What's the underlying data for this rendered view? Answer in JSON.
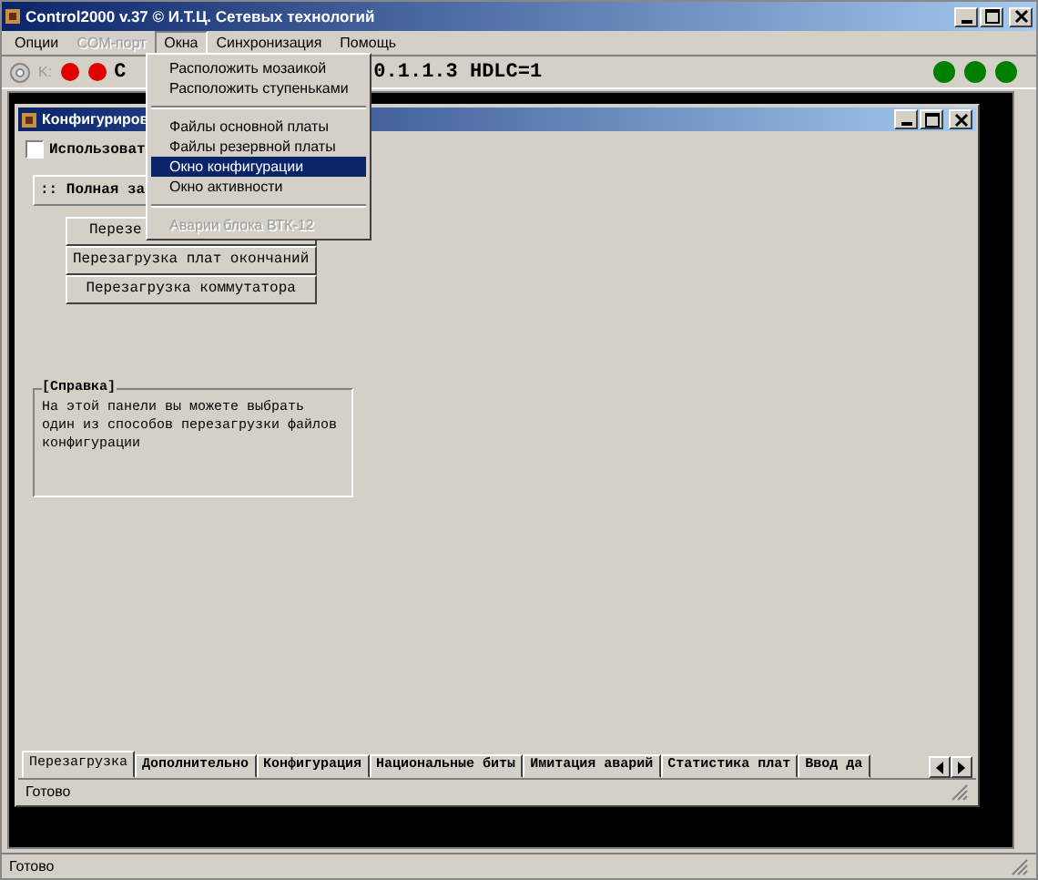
{
  "window": {
    "title": "Control2000 v.37 © И.Т.Ц. Сетевых технологий"
  },
  "menu_bar": [
    {
      "label": "Опции",
      "disabled": false,
      "selected": false
    },
    {
      "label": "COM-порт",
      "disabled": true,
      "selected": false
    },
    {
      "label": "Окна",
      "disabled": false,
      "selected": true
    },
    {
      "label": "Синхронизация",
      "disabled": false,
      "selected": false
    },
    {
      "label": "Помощь",
      "disabled": false,
      "selected": false
    }
  ],
  "toolbar": {
    "port_label": "K:",
    "connection_prefix": "C",
    "connection": "0.1.1.3 HDLC=1"
  },
  "dropdown": [
    {
      "kind": "item",
      "label": "Расположить мозаикой",
      "selected": false,
      "disabled": false
    },
    {
      "kind": "item",
      "label": "Расположить ступеньками",
      "selected": false,
      "disabled": false
    },
    {
      "kind": "separator"
    },
    {
      "kind": "item",
      "label": "Файлы основной платы",
      "selected": false,
      "disabled": false
    },
    {
      "kind": "item",
      "label": "Файлы резервной платы",
      "selected": false,
      "disabled": false
    },
    {
      "kind": "item",
      "label": "Окно конфигурации",
      "selected": true,
      "disabled": false
    },
    {
      "kind": "item",
      "label": "Окно активности",
      "selected": false,
      "disabled": false
    },
    {
      "kind": "separator"
    },
    {
      "kind": "item",
      "label": "Аварии блока ВТК-12",
      "selected": false,
      "disabled": true
    }
  ],
  "child_window": {
    "title": "Конфигуриров",
    "checkbox": {
      "label": "Использоват",
      "checked": false
    },
    "panel_title": ":: Полная за",
    "buttons": [
      "Перезе",
      "Перезагрузка плат окончаний",
      "Перезагрузка коммутатора"
    ],
    "help": {
      "legend": "[Справка]",
      "text": "На этой панели вы можете выбрать один из способов перезагрузки файлов конфигурации"
    },
    "tabs": [
      {
        "label": "Перезагрузка",
        "selected": true
      },
      {
        "label": "Дополнительно",
        "selected": false
      },
      {
        "label": "Конфигурация",
        "selected": false
      },
      {
        "label": "Национальные биты",
        "selected": false
      },
      {
        "label": "Имитация аварий",
        "selected": false
      },
      {
        "label": "Статистика плат",
        "selected": false
      },
      {
        "label": "Ввод да",
        "selected": false
      }
    ],
    "status": "Готово"
  },
  "status_bar": "Готово"
}
